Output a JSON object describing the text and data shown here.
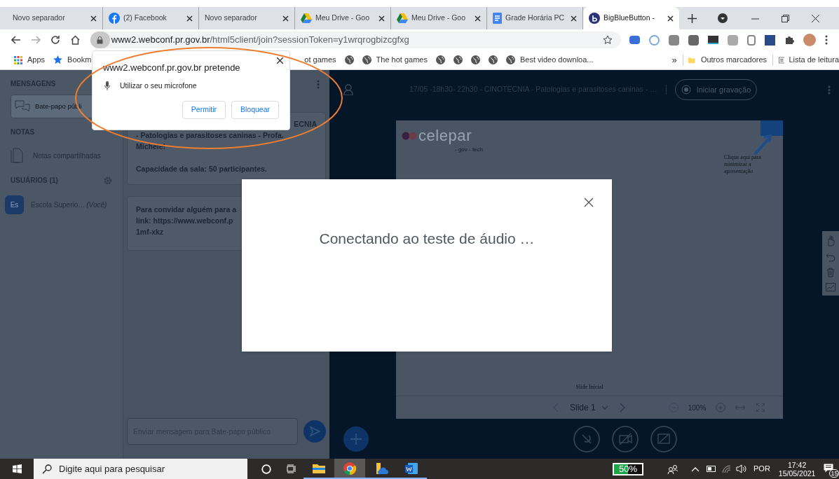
{
  "browser": {
    "tabs": [
      {
        "title": "Novo separador",
        "kind": "plain",
        "selected": false
      },
      {
        "title": "(2) Facebook",
        "kind": "facebook",
        "selected": false
      },
      {
        "title": "Novo separador",
        "kind": "plain",
        "selected": false
      },
      {
        "title": "Meu Drive - Goo",
        "kind": "drive",
        "selected": false
      },
      {
        "title": "Meu Drive - Goo",
        "kind": "drive",
        "selected": false
      },
      {
        "title": "Grade Horária PC",
        "kind": "docs",
        "selected": false
      },
      {
        "title": "BigBlueButton -",
        "kind": "bbb",
        "selected": true
      }
    ],
    "address": {
      "host": "www2.webconf.pr.gov.br",
      "path": "/html5client/join?sessionToken=y1wrqrogbizcgfxg"
    },
    "bookmarks": [
      {
        "kind": "apps",
        "label": "Apps"
      },
      {
        "kind": "star",
        "label": "Bookm"
      },
      {
        "kind": "text",
        "label": "ot games"
      },
      {
        "kind": "globe"
      },
      {
        "kind": "globe",
        "label": "The hot games"
      },
      {
        "kind": "globe"
      },
      {
        "kind": "globe"
      },
      {
        "kind": "globe"
      },
      {
        "kind": "globe"
      },
      {
        "kind": "globe",
        "label": "Best video downloa..."
      }
    ],
    "bookmarks_overflow": "»",
    "other_bookmarks": "Outros marcadores",
    "reading_list": "Lista de leitura",
    "permission_popup": {
      "title": "www2.webconf.pr.gov.br pretende",
      "request": "Utilizar o seu microfone",
      "buttons": [
        "Permitir",
        "Bloquear"
      ]
    }
  },
  "sidebar": {
    "messages_heading": "MENSAGENS",
    "chat_item": "Bate-papo públi",
    "notes_heading": "NOTAS",
    "notes_item": "Notas compartilhadas",
    "users_heading": "USUÁRIOS (1)",
    "user": {
      "initials": "Es",
      "name": "Escola Superio…",
      "suffix": "(Você)"
    }
  },
  "chat": {
    "messages": [
      {
        "lines": [
          "ECNIA",
          "- Patologias e parasitoses caninas - Profa.",
          "Michele!",
          "Capacidade da sala: 50 participantes."
        ]
      },
      {
        "lines": [
          "Para convidar alguém para a",
          "link: https://www.webconf.p",
          "1mf-xkz"
        ]
      }
    ],
    "placeholder": "Enviar mensagem para Bate-papo público"
  },
  "presentation": {
    "title": "17/05 -18h30- 22h30 - CINOTECNIA - Patologias e parasitoses caninas - …",
    "record_button": "Iniciar gravação",
    "slide": {
      "logo": "celepar",
      "tagline": "- gov - tech",
      "minimize_hint": "Clique aqui para minimizar a apresentação",
      "footer": "Slide Inicial"
    },
    "toolbar": {
      "slide_label": "Slide 1",
      "zoom": "100%"
    }
  },
  "modal": {
    "message": "Conectando ao teste de áudio …"
  },
  "taskbar": {
    "search_placeholder": "Digite aqui para pesquisar",
    "apps": [
      {
        "kind": "explorer",
        "selected": false
      },
      {
        "kind": "chrome",
        "selected": true
      },
      {
        "kind": "onedrive",
        "selected": false
      },
      {
        "kind": "word",
        "selected": false
      }
    ],
    "battery_widget": "50%",
    "language": "POR",
    "time": "17:42",
    "date": "15/05/2021",
    "notifications": "15"
  }
}
